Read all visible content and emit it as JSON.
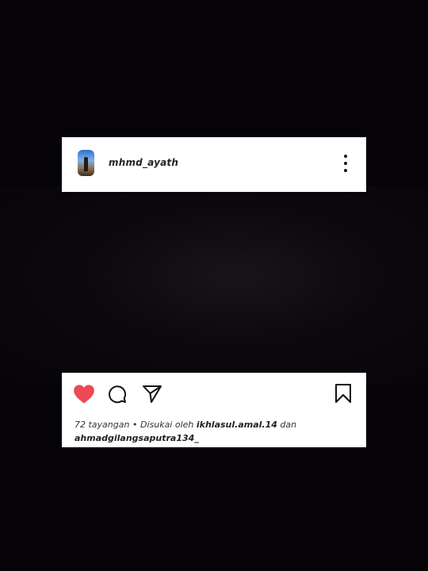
{
  "post": {
    "username": "mhmd_ayath",
    "views": "72 tayangan",
    "separator": "•",
    "liked_by_prefix": "Disukai oleh",
    "liker1": "ikhlasul.amal.14",
    "conjunction": "dan",
    "liker2": "ahmadgilangsaputra134_"
  },
  "icons": {
    "heart": "heart-icon",
    "comment": "comment-icon",
    "share": "send-icon",
    "save": "bookmark-icon",
    "more": "more-vertical-icon"
  },
  "colors": {
    "background": "#050308",
    "card": "#ffffff",
    "heart": "#ed4956",
    "text": "#222222"
  }
}
